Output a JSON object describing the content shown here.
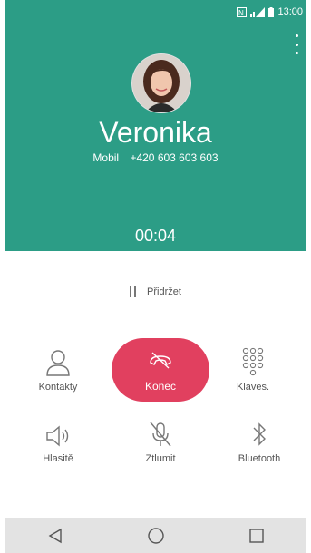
{
  "status_bar": {
    "time": "13:00",
    "icons": [
      "nfc-icon",
      "signal-icon",
      "battery-icon"
    ]
  },
  "contact": {
    "name": "Veronika",
    "number_type": "Mobil",
    "number": "+420 603 603 603"
  },
  "call": {
    "timer": "00:04"
  },
  "hold": {
    "label": "Přidržet"
  },
  "controls": {
    "contacts": "Kontakty",
    "end": "Konec",
    "keypad": "Kláves.",
    "speaker": "Hlasitě",
    "mute": "Ztlumit",
    "bluetooth": "Bluetooth"
  },
  "colors": {
    "header": "#2c9d86",
    "end_button": "#e1405f",
    "nav_bar": "#e3e3e3"
  }
}
